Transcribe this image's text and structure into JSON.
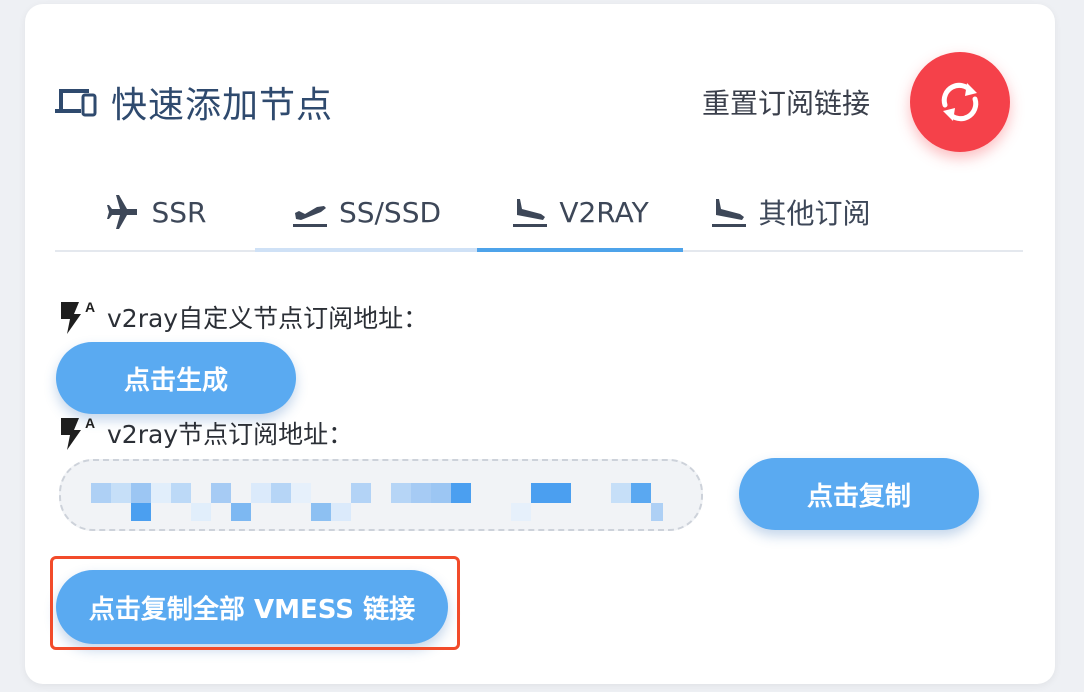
{
  "header": {
    "title": "快速添加节点",
    "reset_label": "重置订阅链接",
    "accent": "#f5414a"
  },
  "tabs": [
    {
      "label": "SSR",
      "icon": "airplane-icon"
    },
    {
      "label": "SS/SSD",
      "icon": "flight-takeoff-icon"
    },
    {
      "label": "V2RAY",
      "icon": "flight-landing-icon",
      "active": true
    },
    {
      "label": "其他订阅",
      "icon": "flight-landing-icon"
    }
  ],
  "custom_sub": {
    "label": "v2ray自定义节点订阅地址：",
    "button": "点击生成"
  },
  "sub": {
    "label": "v2ray节点订阅地址：",
    "value_placeholder": "",
    "button": "点击复制"
  },
  "copy_all": {
    "button": "点击复制全部 VMESS 链接"
  },
  "colors": {
    "primary_button": "#5aaaf1",
    "active_tab": "#4ea3ea",
    "highlight": "#f24b2a"
  }
}
